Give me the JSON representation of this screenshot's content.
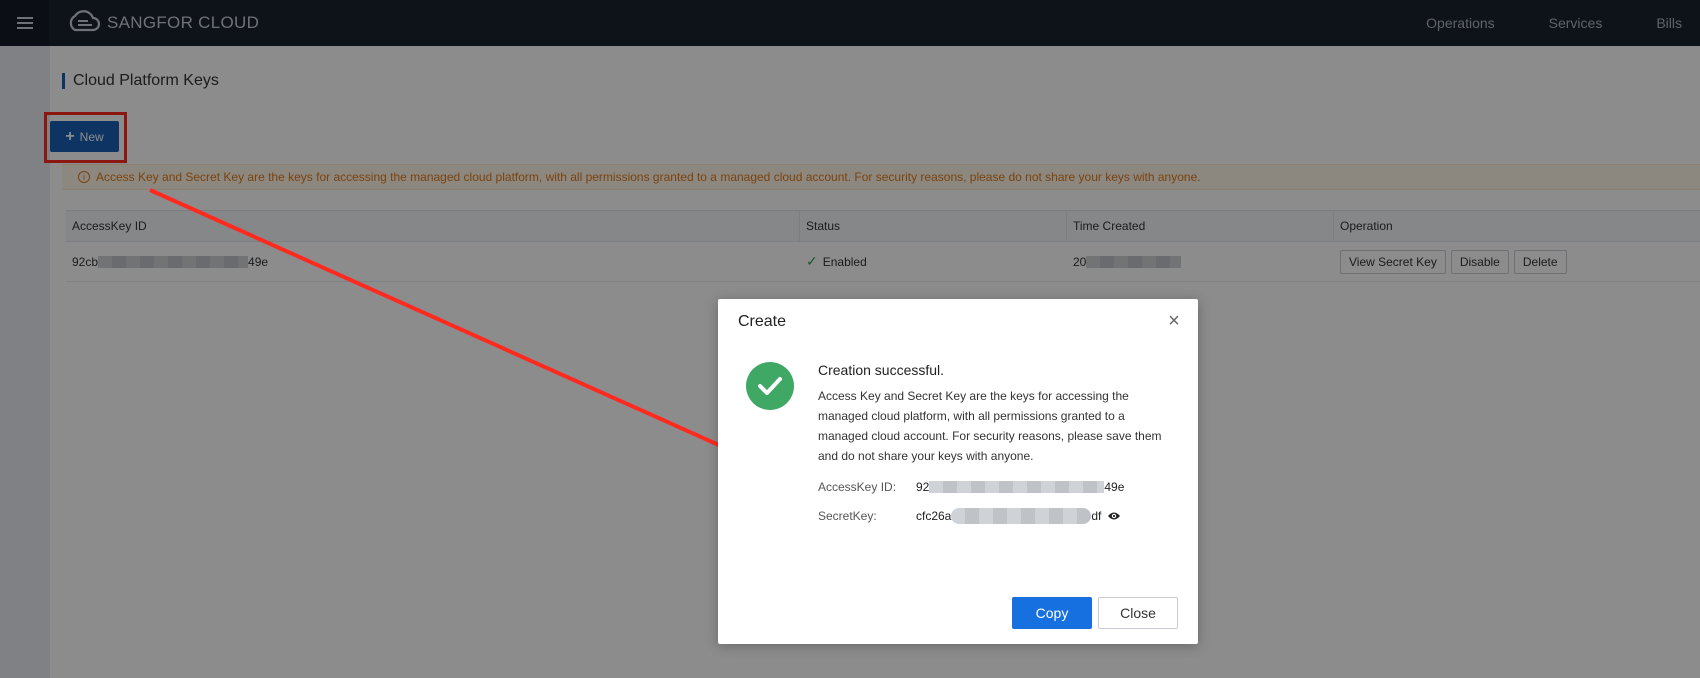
{
  "header": {
    "brand": "SANGFOR CLOUD",
    "nav": [
      "Operations",
      "Services",
      "Bills"
    ]
  },
  "page": {
    "title": "Cloud Platform Keys",
    "new_label": "New",
    "notice": "Access Key and Secret Key are the keys for accessing the managed cloud platform, with all permissions granted to a managed cloud account. For security reasons, please do not share your keys with anyone."
  },
  "table": {
    "columns": [
      "AccessKey ID",
      "Status",
      "Time Created",
      "Operation"
    ],
    "rows": [
      {
        "access_key_prefix": "92cb",
        "access_key_suffix": "49e",
        "status": "Enabled",
        "time_prefix": "20",
        "actions": [
          "View Secret Key",
          "Disable",
          "Delete"
        ]
      }
    ]
  },
  "dialog": {
    "title": "Create",
    "heading": "Creation successful.",
    "description": "Access Key and Secret Key are the keys for accessing the managed cloud platform, with all permissions granted to a managed cloud account. For security reasons, please save them and do not share your keys with anyone.",
    "access_key_label": "AccessKey ID:",
    "access_key_prefix": "92",
    "access_key_suffix": "49e",
    "secret_key_label": "SecretKey:",
    "secret_key_prefix": "cfc26a",
    "secret_key_suffix": "df",
    "copy_label": "Copy",
    "close_label": "Close"
  },
  "colors": {
    "primary": "#1a5fb4",
    "button_blue": "#1670e0",
    "success": "#3fa864",
    "warning": "#e07b1a",
    "annotation": "#ff2a1f"
  }
}
